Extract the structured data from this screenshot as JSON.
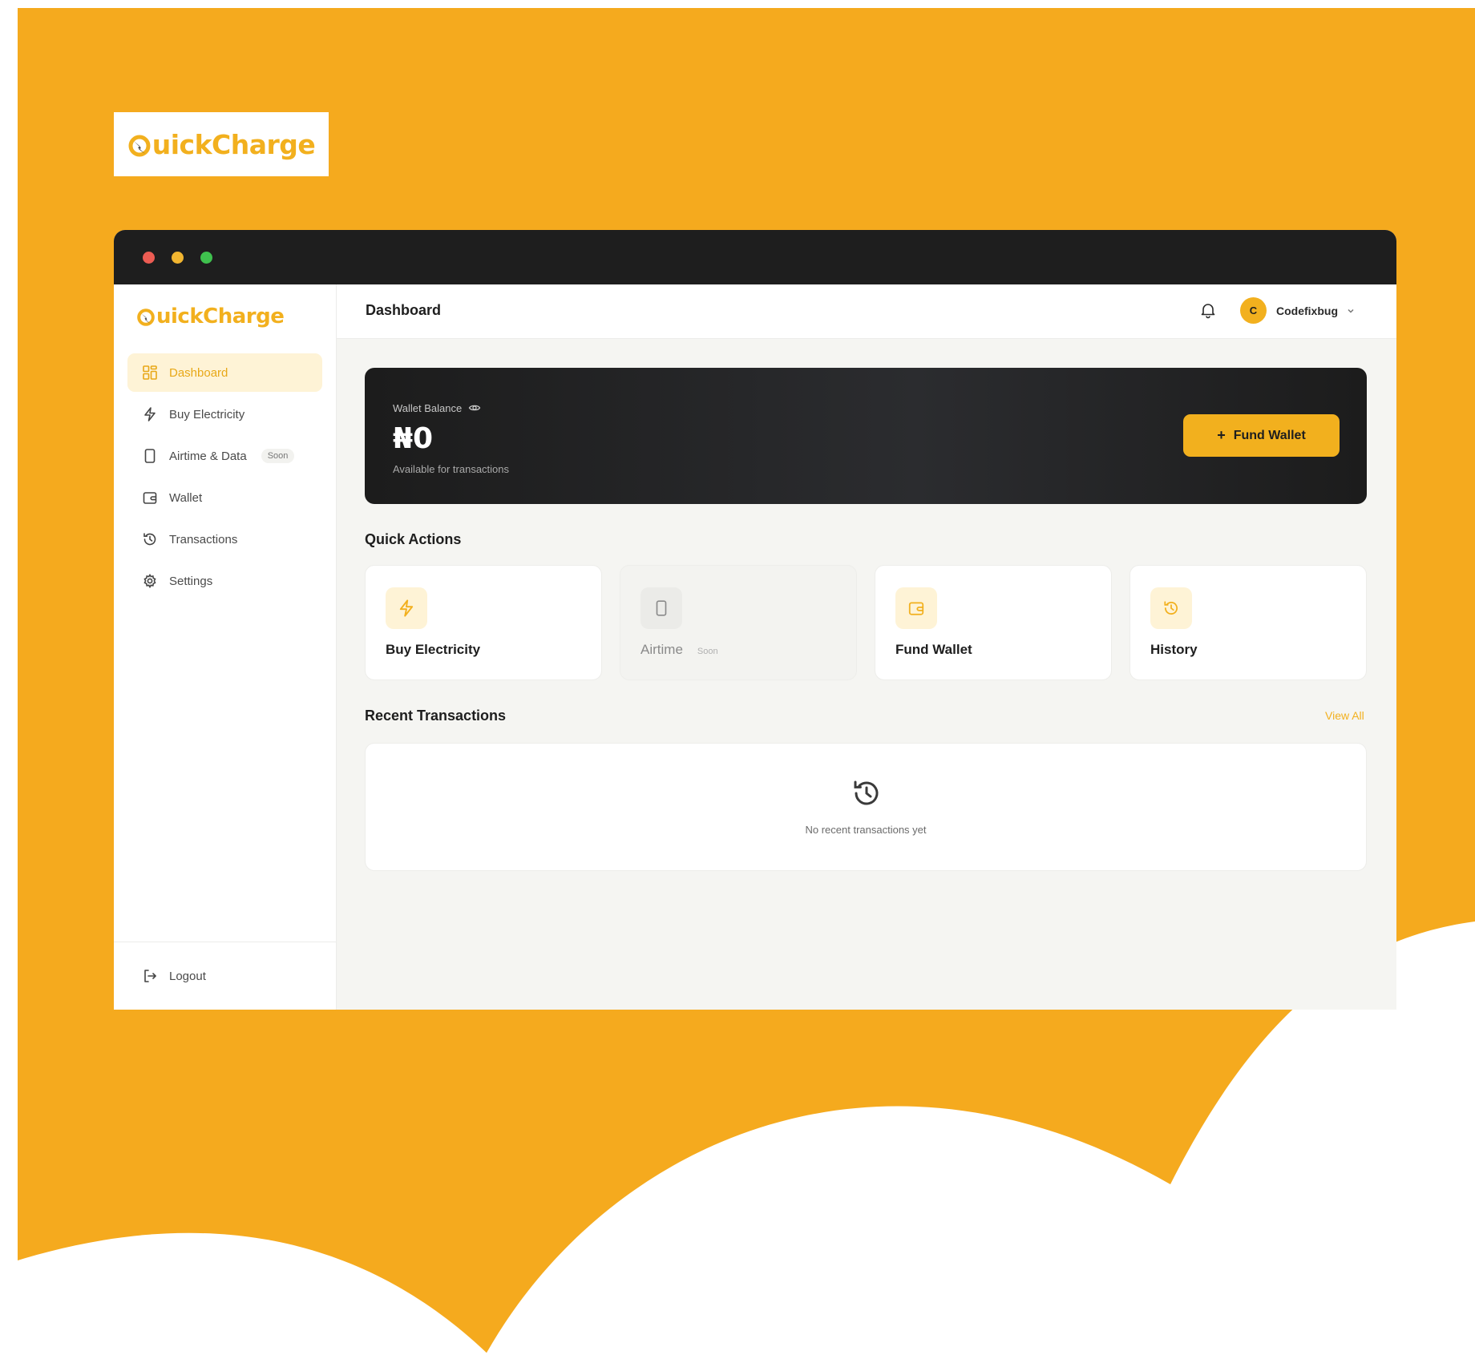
{
  "brand": {
    "name": "QuickCharge",
    "logo_rest": "uickCharge",
    "color": "#F2B01E",
    "background_color": "#F5AA1E"
  },
  "sidebar": {
    "items": [
      {
        "label": "Dashboard",
        "icon": "grid-icon",
        "active": true
      },
      {
        "label": "Buy Electricity",
        "icon": "lightning-icon"
      },
      {
        "label": "Airtime & Data",
        "icon": "phone-icon",
        "badge": "Soon"
      },
      {
        "label": "Wallet",
        "icon": "wallet-icon"
      },
      {
        "label": "Transactions",
        "icon": "history-icon"
      },
      {
        "label": "Settings",
        "icon": "gear-icon"
      }
    ],
    "logout_label": "Logout"
  },
  "topbar": {
    "title": "Dashboard",
    "user": {
      "initial": "C",
      "name": "Codefixbug"
    }
  },
  "wallet": {
    "label": "Wallet Balance",
    "amount": "₦0",
    "subtitle": "Available for transactions",
    "fund_button": "Fund Wallet"
  },
  "quick_actions": {
    "title": "Quick Actions",
    "items": [
      {
        "label": "Buy Electricity",
        "icon": "lightning-icon"
      },
      {
        "label": "Airtime",
        "icon": "phone-icon",
        "badge": "Soon",
        "disabled": true
      },
      {
        "label": "Fund Wallet",
        "icon": "wallet-icon"
      },
      {
        "label": "History",
        "icon": "history-icon"
      }
    ]
  },
  "recent_transactions": {
    "title": "Recent Transactions",
    "view_all": "View All",
    "empty_text": "No recent transactions yet"
  }
}
